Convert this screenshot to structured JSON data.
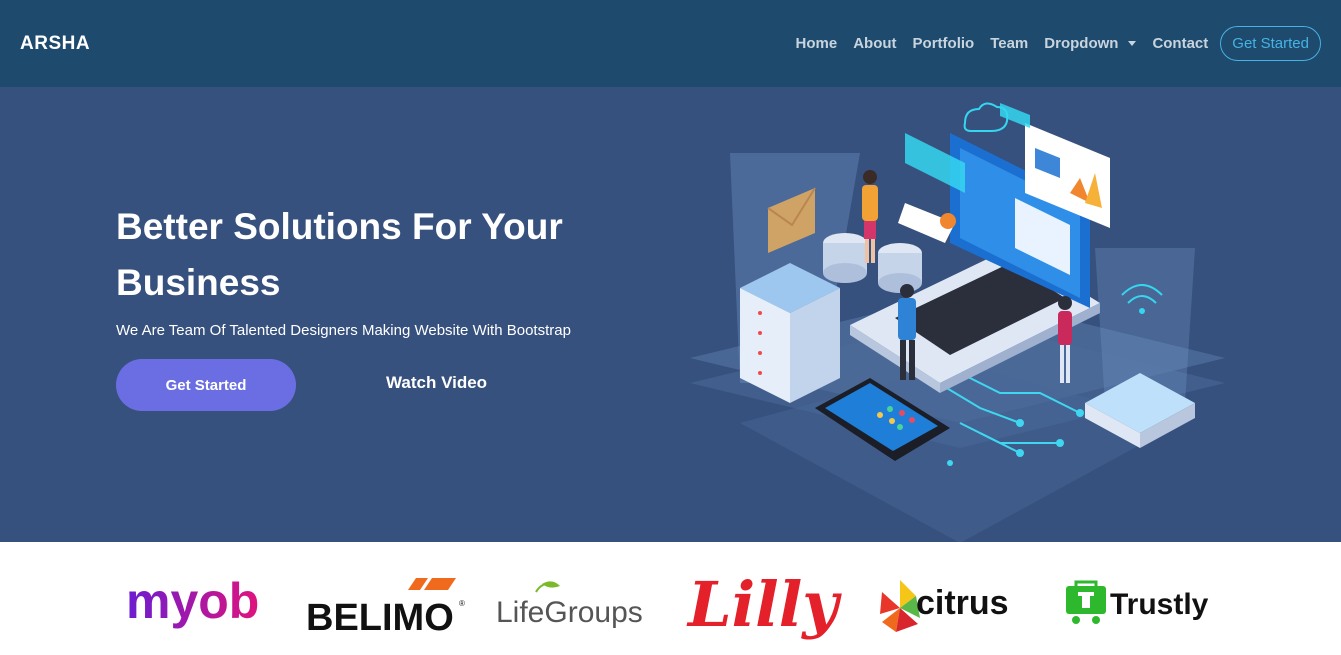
{
  "header": {
    "logo": "ARSHA",
    "nav": {
      "home": "Home",
      "about": "About",
      "portfolio": "Portfolio",
      "team": "Team",
      "dropdown": "Dropdown",
      "contact": "Contact"
    },
    "cta_label": "Get Started"
  },
  "hero": {
    "title": "Better Solutions For Your Business",
    "subtitle": "We Are Team Of Talented Designers Making Website With Bootstrap",
    "get_started_label": "Get Started",
    "watch_video_label": "Watch Video"
  },
  "clients": {
    "myob": "myob",
    "belimo": "BELIMO",
    "lifegroups": "LifeGroups",
    "lilly": "Lilly",
    "citrus": "citrus",
    "trustly": "Trustly"
  },
  "colors": {
    "header_bg": "#1d4a6d",
    "hero_bg": "#37517e",
    "accent": "#47b2e4",
    "button": "#6b6ee3"
  }
}
